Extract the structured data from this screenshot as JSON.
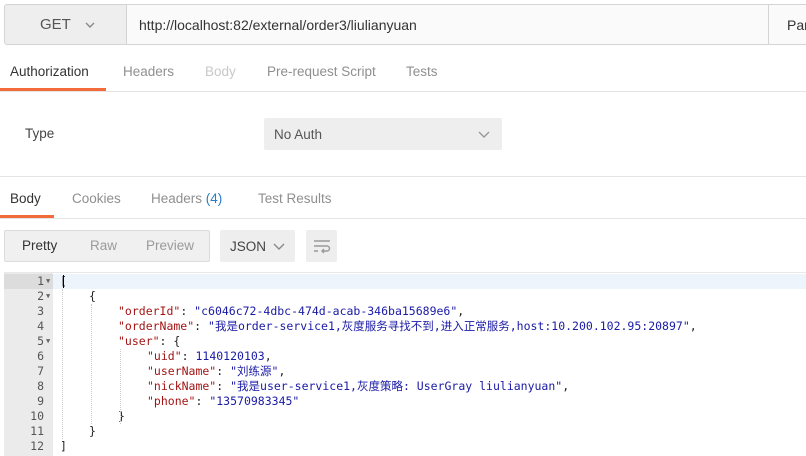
{
  "request": {
    "method": "GET",
    "url": "http://localhost:82/external/order3/liulianyuan",
    "params_label": "Params"
  },
  "request_tabs": [
    {
      "label": "Authorization",
      "active": true
    },
    {
      "label": "Headers"
    },
    {
      "label": "Body",
      "disabled": true
    },
    {
      "label": "Pre-request Script"
    },
    {
      "label": "Tests"
    }
  ],
  "auth": {
    "type_label": "Type",
    "type_value": "No Auth"
  },
  "response_tabs": {
    "body": "Body",
    "cookies": "Cookies",
    "headers": "Headers",
    "headers_count": "(4)",
    "test_results": "Test Results"
  },
  "view": {
    "pretty": "Pretty",
    "raw": "Raw",
    "preview": "Preview",
    "format": "JSON"
  },
  "colors": {
    "accent": "#f26b3a",
    "json_key": "#a31515",
    "json_value": "#1a1aa6"
  },
  "code_lines": [
    {
      "n": "1",
      "fold": true,
      "indent": 0,
      "parts": [
        [
          "p",
          "["
        ]
      ]
    },
    {
      "n": "2",
      "fold": true,
      "indent": 1,
      "parts": [
        [
          "p",
          "{"
        ]
      ]
    },
    {
      "n": "3",
      "indent": 2,
      "parts": [
        [
          "k",
          "\"orderId\""
        ],
        [
          "p",
          ": "
        ],
        [
          "s",
          "\"c6046c72-4dbc-474d-acab-346ba15689e6\""
        ],
        [
          "p",
          ","
        ]
      ]
    },
    {
      "n": "4",
      "indent": 2,
      "parts": [
        [
          "k",
          "\"orderName\""
        ],
        [
          "p",
          ": "
        ],
        [
          "s",
          "\"我是order-service1,灰度服务寻找不到,进入正常服务,host:10.200.102.95:20897\""
        ],
        [
          "p",
          ","
        ]
      ]
    },
    {
      "n": "5",
      "fold": true,
      "indent": 2,
      "parts": [
        [
          "k",
          "\"user\""
        ],
        [
          "p",
          ": {"
        ]
      ]
    },
    {
      "n": "6",
      "indent": 3,
      "parts": [
        [
          "k",
          "\"uid\""
        ],
        [
          "p",
          ": "
        ],
        [
          "n",
          "1140120103"
        ],
        [
          "p",
          ","
        ]
      ]
    },
    {
      "n": "7",
      "indent": 3,
      "parts": [
        [
          "k",
          "\"userName\""
        ],
        [
          "p",
          ": "
        ],
        [
          "s",
          "\"刘练源\""
        ],
        [
          "p",
          ","
        ]
      ]
    },
    {
      "n": "8",
      "indent": 3,
      "parts": [
        [
          "k",
          "\"nickName\""
        ],
        [
          "p",
          ": "
        ],
        [
          "s",
          "\"我是user-service1,灰度策略: UserGray liulianyuan\""
        ],
        [
          "p",
          ","
        ]
      ]
    },
    {
      "n": "9",
      "indent": 3,
      "parts": [
        [
          "k",
          "\"phone\""
        ],
        [
          "p",
          ": "
        ],
        [
          "s",
          "\"13570983345\""
        ]
      ]
    },
    {
      "n": "10",
      "indent": 2,
      "parts": [
        [
          "p",
          "}"
        ]
      ]
    },
    {
      "n": "11",
      "indent": 1,
      "parts": [
        [
          "p",
          "}"
        ]
      ]
    },
    {
      "n": "12",
      "indent": 0,
      "parts": [
        [
          "p",
          "]"
        ]
      ]
    }
  ]
}
